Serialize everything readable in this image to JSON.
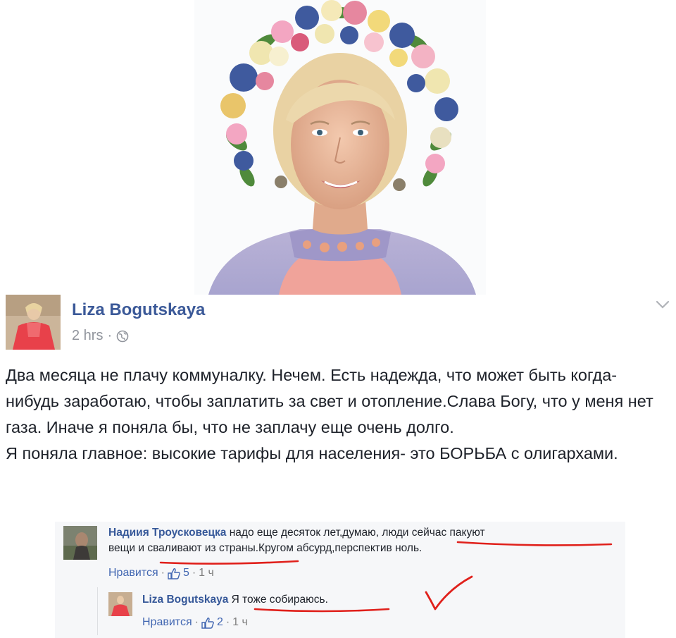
{
  "post": {
    "author": "Liza Bogutskaya",
    "time": "2 hrs",
    "separator": "·",
    "paragraphs": [
      "Два месяца не плачу коммуналку. Нечем. Есть надежда, что может быть когда- нибудь заработаю, чтобы заплатить за свет и отопление.Слава Богу, что у меня нет газа. Иначе я поняла бы, что не заплачу еще очень долго.",
      "Я поняла главное: высокие тарифы для населения- это БОРЬБА с олигархами."
    ]
  },
  "comments": [
    {
      "author": "Надиия Троусковецка",
      "text_line1": "надо еще десяток лет,думаю, люди сейчас пакуют",
      "text_line2": "вещи и сваливают из страны.Кругом абсурд,перспектив ноль.",
      "like_label": "Нравится",
      "dot": "·",
      "likes": "5",
      "time": "1 ч"
    },
    {
      "author": "Liza Bogutskaya",
      "text": "Я тоже собираюсь.",
      "like_label": "Нравится",
      "dot": "·",
      "likes": "2",
      "time": "1 ч"
    }
  ],
  "icons": {
    "globe": "globe-icon",
    "chevron": "chevron-down-icon",
    "thumb": "thumbs-up-icon"
  },
  "colors": {
    "link": "#3b5998",
    "underline_marker": "#e0201b"
  }
}
